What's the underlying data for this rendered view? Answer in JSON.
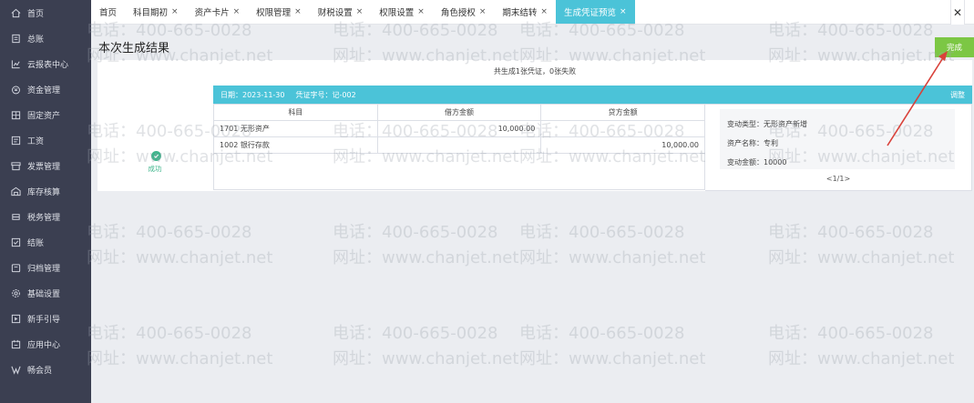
{
  "sidebar": {
    "items": [
      {
        "label": "首页",
        "icon": "home-icon"
      },
      {
        "label": "总账",
        "icon": "ledger-icon"
      },
      {
        "label": "云报表中心",
        "icon": "chart-icon"
      },
      {
        "label": "资金管理",
        "icon": "money-icon"
      },
      {
        "label": "固定资产",
        "icon": "asset-icon"
      },
      {
        "label": "工资",
        "icon": "salary-icon"
      },
      {
        "label": "发票管理",
        "icon": "invoice-icon"
      },
      {
        "label": "库存核算",
        "icon": "warehouse-icon"
      },
      {
        "label": "税务管理",
        "icon": "tax-icon"
      },
      {
        "label": "结账",
        "icon": "checkout-icon"
      },
      {
        "label": "归档管理",
        "icon": "archive-icon"
      },
      {
        "label": "基础设置",
        "icon": "settings-icon"
      },
      {
        "label": "新手引导",
        "icon": "guide-icon"
      },
      {
        "label": "应用中心",
        "icon": "apps-icon"
      },
      {
        "label": "畅会员",
        "icon": "vip-icon"
      }
    ]
  },
  "tabs": [
    {
      "label": "首页",
      "closable": false
    },
    {
      "label": "科目期初",
      "closable": true
    },
    {
      "label": "资产卡片",
      "closable": true
    },
    {
      "label": "权限管理",
      "closable": true
    },
    {
      "label": "财税设置",
      "closable": true
    },
    {
      "label": "权限设置",
      "closable": true
    },
    {
      "label": "角色授权",
      "closable": true
    },
    {
      "label": "期末结转",
      "closable": true
    },
    {
      "label": "生成凭证预览",
      "closable": true,
      "active": true
    }
  ],
  "tab_close_symbol": "×",
  "tab_close_all": "✕",
  "page": {
    "title": "本次生成结果",
    "done_button": "完成",
    "summary": "共生成1张凭证，0张失败",
    "status_label": "成功"
  },
  "voucher": {
    "date": "日期：2023-11-30",
    "number": "凭证字号：记-002",
    "adjust": "调整",
    "headers": [
      "科目",
      "借方金额",
      "贷方金额"
    ],
    "rows": [
      {
        "account": "1701 无形资产",
        "debit": "10,000.00",
        "credit": ""
      },
      {
        "account": "1002 银行存款",
        "debit": "",
        "credit": "10,000.00"
      }
    ]
  },
  "detail": {
    "change_type": "变动类型：无形资产新增",
    "asset_name": "资产名称：专利",
    "change_amount": "变动金额：10000",
    "pager": "<1/1>"
  },
  "watermark": {
    "phone": "电话：400-665-0028",
    "site": "网址：www.chanjet.net"
  },
  "colors": {
    "sidebar_bg": "#3b3f51",
    "accent": "#4bc3d8",
    "done_green": "#7cc744",
    "success_green": "#3fb58c",
    "arrow_red": "#d9413a"
  }
}
